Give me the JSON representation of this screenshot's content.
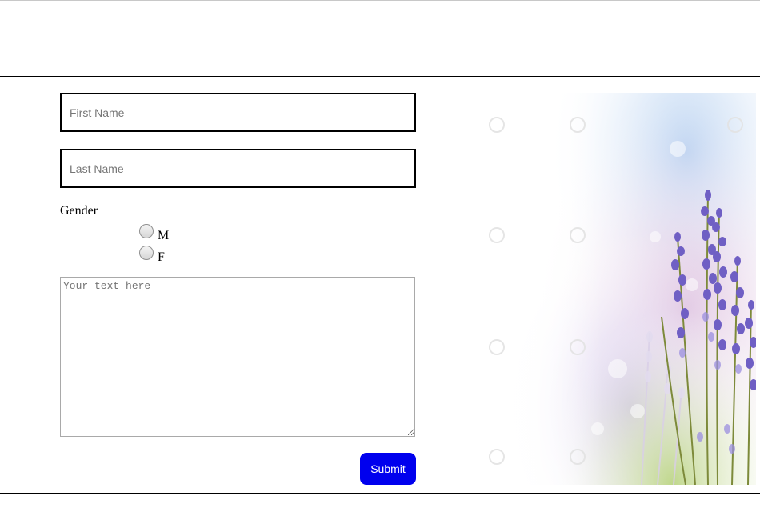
{
  "form": {
    "first_name_placeholder": "First Name",
    "last_name_placeholder": "Last Name",
    "gender_label": "Gender",
    "gender_options": [
      {
        "label": "M",
        "selected": false
      },
      {
        "label": "F",
        "selected": false
      }
    ],
    "comment_placeholder": "Your text here",
    "submit_label": "Submit"
  },
  "colors": {
    "submit_button": "#0000ee",
    "input_border": "#000000",
    "flower_purple": "#6a5acd"
  },
  "image": {
    "subject": "lavender flowers illustration",
    "watermark_icon": "camera-watermark-icon"
  }
}
